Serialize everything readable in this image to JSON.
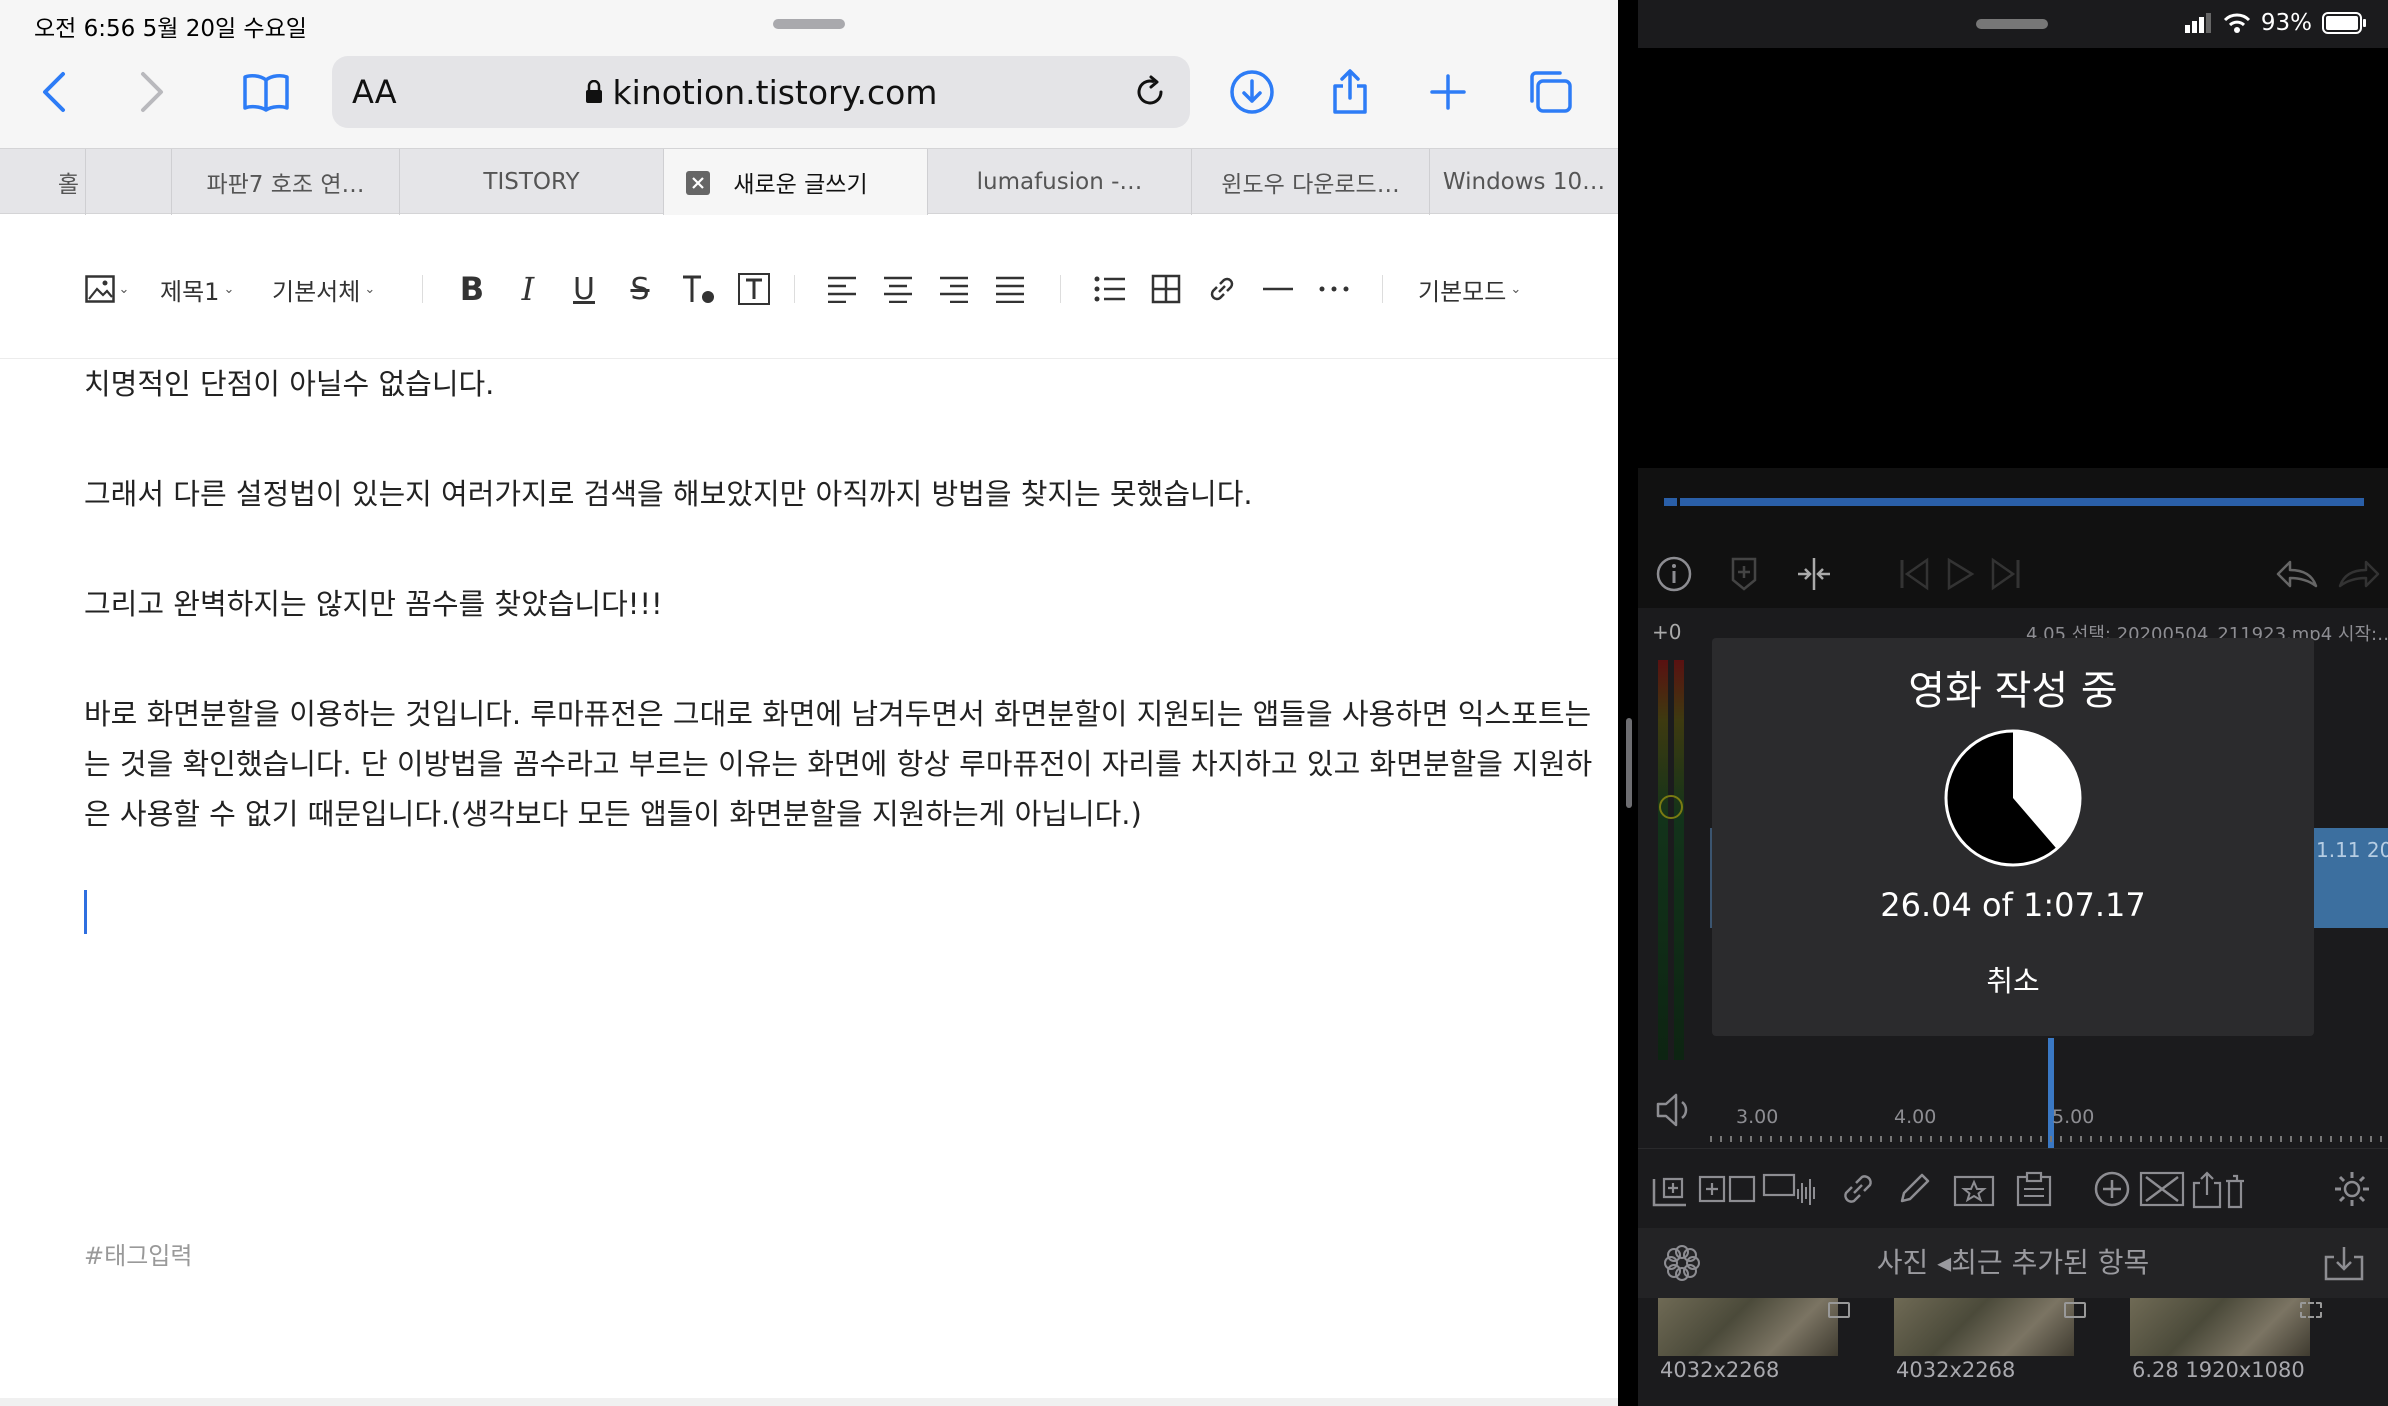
{
  "status": {
    "time_date": "오전 6:56   5월 20일 수요일",
    "battery": "93%"
  },
  "safari": {
    "aa_label": "AA",
    "url": "kinotion.tistory.com",
    "tabs": [
      {
        "label": "홀"
      },
      {
        "label": ""
      },
      {
        "label": "파판7 호조 연…"
      },
      {
        "label": "TISTORY"
      },
      {
        "label": "새로운 글쓰기"
      },
      {
        "label": "lumafusion -…"
      },
      {
        "label": "윈도우 다운로드…"
      },
      {
        "label": "Windows 10…"
      }
    ]
  },
  "editor_toolbar": {
    "heading": "제목1",
    "font": "기본서체",
    "mode": "기본모드"
  },
  "content": {
    "paragraphs": [
      "치명적인 단점이 아닐수 없습니다.",
      "그래서 다른 설정법이 있는지 여러가지로 검색을 해보았지만 아직까지 방법을 찾지는 못했습니다.",
      "그리고 완벽하지는 않지만 꼼수를 찾았습니다!!!",
      "바로 화면분할을 이용하는 것입니다. 루마퓨전은 그대로 화면에 남겨두면서 화면분할이 지원되는 앱들을 사용하면 익스포트는",
      "는 것을 확인했습니다. 단 이방법을 꼼수라고 부르는 이유는 화면에 항상 루마퓨전이 자리를 차지하고 있고 화면분할을 지원하",
      "은 사용할 수 없기 때문입니다.(생각보다 모든 앱들이 화면분할을 지원하는게 아닙니다.)"
    ],
    "tag_placeholder": "#태그입력"
  },
  "lumafusion": {
    "timeline_info": "4.05 선택: 20200504_211923.mp4 시작:…",
    "volume_offset": "+0",
    "clip_label": "1.11   20",
    "ruler": [
      "3.00",
      "4.00",
      "5.00"
    ],
    "export_modal": {
      "title": "영화 작성 중",
      "progress_text": "26.04 of 1:07.17",
      "progress_fraction": 0.387,
      "cancel": "취소"
    },
    "library_title": "사진 ◂최근 추가된 항목",
    "media": [
      {
        "caption": "4032x2268",
        "badge": "image-icon"
      },
      {
        "caption": "4032x2268",
        "badge": "image-icon"
      },
      {
        "caption": "6.28  1920x1080",
        "badge": "film-icon"
      }
    ]
  }
}
